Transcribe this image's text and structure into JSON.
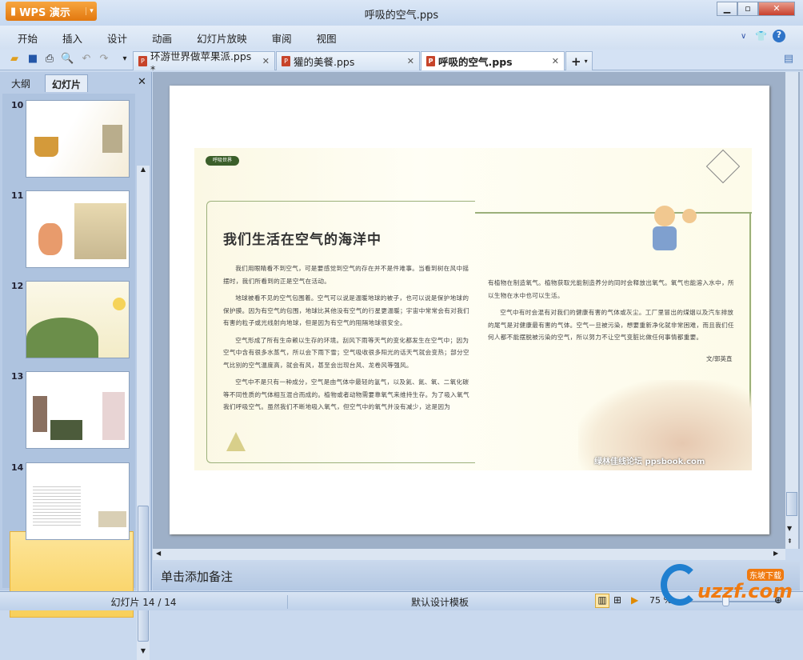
{
  "app": {
    "name": "WPS 演示",
    "title": "呼吸的空气.pps"
  },
  "menu": [
    "开始",
    "插入",
    "设计",
    "动画",
    "幻灯片放映",
    "审阅",
    "视图"
  ],
  "tabs": [
    {
      "label": "环游世界做苹果派.pps *"
    },
    {
      "label": "獾的美餐.pps"
    },
    {
      "label": "呼吸的空气.pps"
    }
  ],
  "left_panel": {
    "tabs": [
      "大纲",
      "幻灯片"
    ],
    "slide_numbers": [
      "10",
      "11",
      "12",
      "13",
      "14"
    ],
    "selected": "14"
  },
  "slide": {
    "badge": "呼吸世界",
    "heading": "我们生活在空气的海洋中",
    "left_paragraphs": [
      "我们用眼睛看不到空气，可是要感觉到空气的存在并不是件难事。当看到树在风中摇摆时，我们所看到的正是空气在活动。",
      "地球被看不见的空气包围着。空气可以说是温暖地球的被子，也可以说是保护地球的保护膜。因为有空气的包围，地球比其他没有空气的行星更温暖；宇宙中常常会有对我们有害的粒子或光线射向地球，但是因为有空气的阻隔地球很安全。",
      "空气形成了所有生命赖以生存的环境。刮风下雨等天气的变化都发生在空气中；因为空气中含有很多水蒸气，所以会下雨下雪；空气吸收很多阳光的话天气就会变热；部分空气比别的空气温度高，就会有风，甚至会出现台风、龙卷风等强风。",
      "空气中不是只有一种成分，空气是由气体中最轻的氢气，以及氦、氮、氧、二氧化碳等不同性质的气体相互混合而成的。植物或者动物需要靠氧气来维持生存。为了吸入氧气我们呼吸空气。虽然我们不断地吸入氧气，但空气中的氧气并没有减少，这是因为"
    ],
    "right_paragraphs": [
      "有植物在制造氧气。植物获取光能制造养分的同时会释放出氧气。氧气也能溶入水中，所以生物在水中也可以生活。",
      "空气中有时会混有对我们的健康有害的气体或灰尘。工厂里冒出的煤烟以及汽车排放的尾气是对健康最有害的气体。空气一旦被污染，想要重新净化就非常困难，而且我们任何人都不能摆脱被污染的空气，所以努力不让空气变脏比做任何事情都重要。"
    ],
    "author": "文/郭英直",
    "watermark": "绿林佳线论坛 ppsbook.com"
  },
  "notes_placeholder": "单击添加备注",
  "status": {
    "slide": "幻灯片 14 / 14",
    "template": "默认设计模板",
    "zoom": "75 %"
  },
  "logo": "uzzf.com 东坡下载"
}
